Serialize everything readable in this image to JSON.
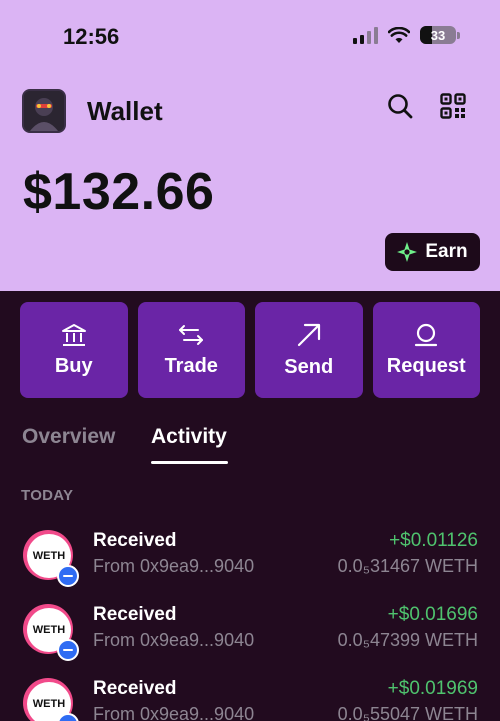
{
  "status": {
    "time": "12:56",
    "battery": "33"
  },
  "header": {
    "title": "Wallet",
    "balance": "$132.66",
    "earn_label": "Earn"
  },
  "actions": [
    {
      "label": "Buy",
      "icon": "bank-icon"
    },
    {
      "label": "Trade",
      "icon": "swap-arrows-icon"
    },
    {
      "label": "Send",
      "icon": "arrow-up-right-icon"
    },
    {
      "label": "Request",
      "icon": "request-icon"
    }
  ],
  "tabs": {
    "overview": "Overview",
    "activity": "Activity",
    "selected": "Activity"
  },
  "section": "TODAY",
  "transactions": [
    {
      "token": "WETH",
      "title": "Received",
      "from": "From 0x9ea9...9040",
      "usd": "+$0.01126",
      "amount": "0.0₅31467 WETH"
    },
    {
      "token": "WETH",
      "title": "Received",
      "from": "From 0x9ea9...9040",
      "usd": "+$0.01696",
      "amount": "0.0₅47399 WETH"
    },
    {
      "token": "WETH",
      "title": "Received",
      "from": "From 0x9ea9...9040",
      "usd": "+$0.01969",
      "amount": "0.0₅55047 WETH"
    }
  ],
  "colors": {
    "header_bg": "#dbb4f4",
    "page_bg": "#220b1f",
    "action_bg": "#6a25a6",
    "positive": "#4fc36e"
  }
}
